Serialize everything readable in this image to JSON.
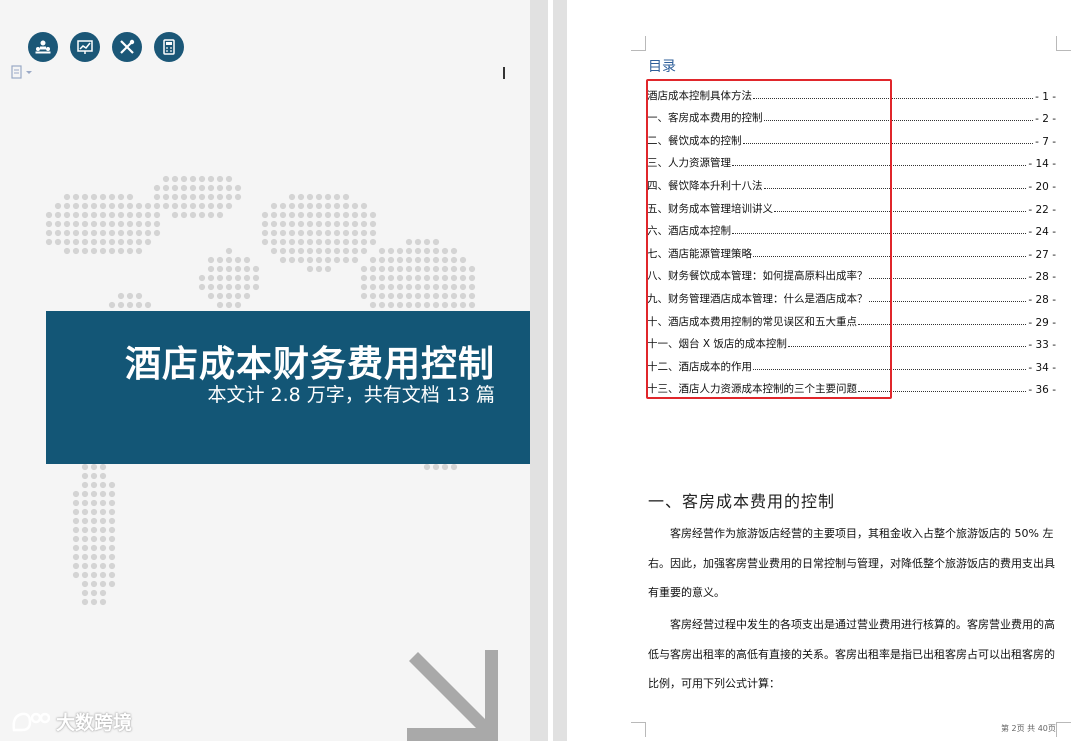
{
  "cover": {
    "icons": [
      "team-icon",
      "chart-board-icon",
      "tools-icon",
      "calculator-icon"
    ],
    "title": "酒店成本财务费用控制",
    "subtitle": "本文计 2.8 万字，共有文档 13 篇",
    "watermark": "大数跨境",
    "banner_color": "#135676"
  },
  "toc": {
    "title": "目录",
    "entries": [
      {
        "text": "酒店成本控制具体方法",
        "page": "- 1 -"
      },
      {
        "text": "一、客房成本费用的控制",
        "page": "- 2 -"
      },
      {
        "text": "二、餐饮成本的控制",
        "page": "- 7 -"
      },
      {
        "text": "三、人力资源管理",
        "page": "- 14 -"
      },
      {
        "text": "四、餐饮降本升利十八法",
        "page": "- 20 -"
      },
      {
        "text": "五、财务成本管理培训讲义",
        "page": "- 22 -"
      },
      {
        "text": "六、酒店成本控制",
        "page": "- 24 -"
      },
      {
        "text": "七、酒店能源管理策略",
        "page": "- 27 -"
      },
      {
        "text": "八、财务餐饮成本管理：如何提高原料出成率？",
        "page": "- 28 -"
      },
      {
        "text": "九、财务管理酒店成本管理：什么是酒店成本？",
        "page": "- 28 -"
      },
      {
        "text": "十、酒店成本费用控制的常见误区和五大重点",
        "page": "- 29 -"
      },
      {
        "text": "十一、烟台 X 饭店的成本控制",
        "page": "- 33 -"
      },
      {
        "text": "十二、酒店成本的作用",
        "page": "- 34 -"
      },
      {
        "text": "十三、酒店人力资源成本控制的三个主要问题",
        "page": "- 36 -"
      }
    ],
    "highlight_color": "#e0262b"
  },
  "section": {
    "heading": "一、客房成本费用的控制",
    "paragraphs": [
      "客房经营作为旅游饭店经营的主要项目，其租金收入占整个旅游饭店的 50% 左右。因此，加强客房营业费用的日常控制与管理，对降低整个旅游饭店的费用支出具有重要的意义。",
      "客房经营过程中发生的各项支出是通过营业费用进行核算的。客房营业费用的高低与客房出租率的高低有直接的关系。客房出租率是指已出租客房占可以出租客房的比例，可用下列公式计算："
    ]
  },
  "footer": {
    "page_indicator": "第 2页 共 40页"
  }
}
